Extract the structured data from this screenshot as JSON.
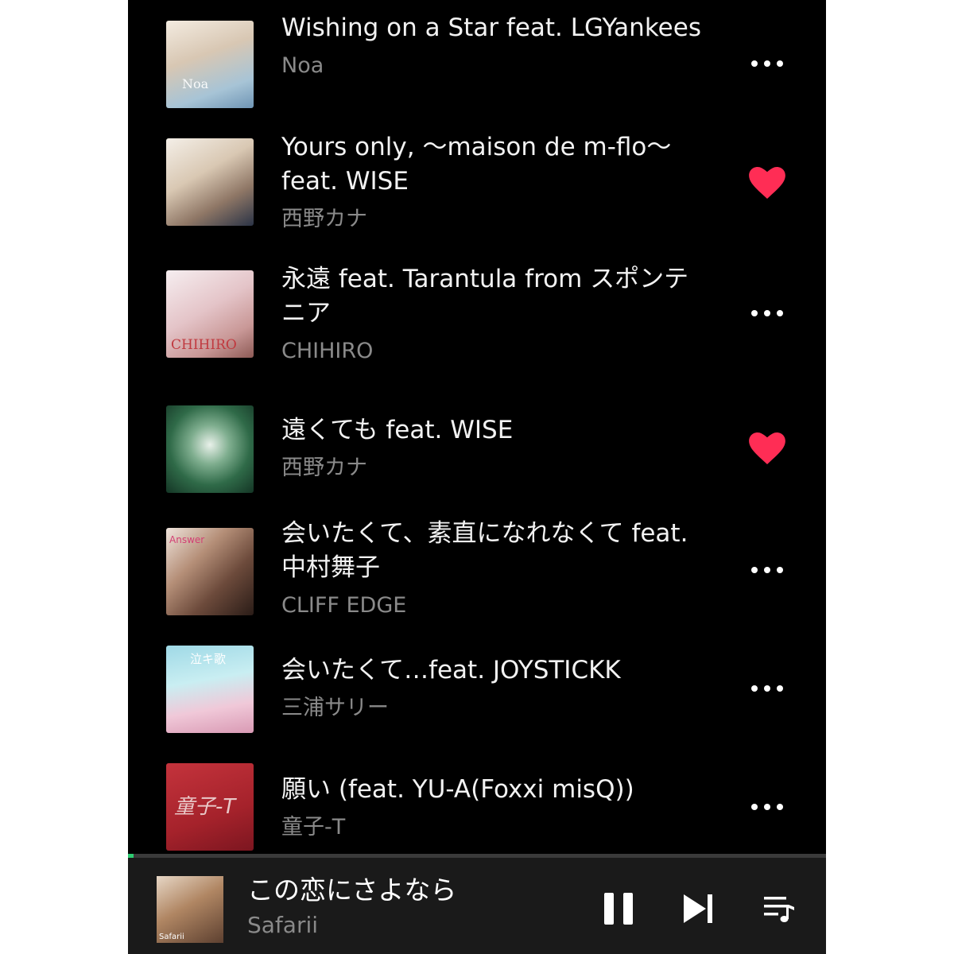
{
  "colors": {
    "background": "#000000",
    "title_text": "#f2f2f2",
    "artist_text": "#8a8a8a",
    "heart": "#ff2d55",
    "progress": "#2ecc71",
    "player_bg": "#1a1a1a"
  },
  "songs": [
    {
      "title": "Wishing on a Star feat. LGYankees",
      "artist": "Noa",
      "action": "more",
      "art_text": "Noa"
    },
    {
      "title": "Yours only, ～maison de m-flo～ feat. WISE",
      "artist": "西野カナ",
      "action": "liked",
      "art_text": ""
    },
    {
      "title": "永遠 feat. Tarantula from スポンテニア",
      "artist": "CHIHIRO",
      "action": "more",
      "art_text": "CHIHIRO"
    },
    {
      "title": "遠くても feat. WISE",
      "artist": "西野カナ",
      "action": "liked",
      "art_text": ""
    },
    {
      "title": "会いたくて、素直になれなくて feat. 中村舞子",
      "artist": "CLIFF EDGE",
      "action": "more",
      "art_text": "Answer"
    },
    {
      "title": "会いたくて…feat. JOYSTICKK",
      "artist": "三浦サリー",
      "action": "more",
      "art_text": "泣キ歌"
    },
    {
      "title": "願い (feat. YU-A(Foxxi misQ))",
      "artist": "童子-T",
      "action": "more",
      "art_text": "童子-T"
    }
  ],
  "now_playing": {
    "title": "この恋にさよなら",
    "artist": "Safarii",
    "art_text": "Safarii",
    "progress": 0.008,
    "state": "playing"
  },
  "icons": {
    "more": "more-horizontal-icon",
    "liked": "heart-filled-icon",
    "pause": "pause-icon",
    "next": "skip-next-icon",
    "queue": "queue-music-icon"
  }
}
